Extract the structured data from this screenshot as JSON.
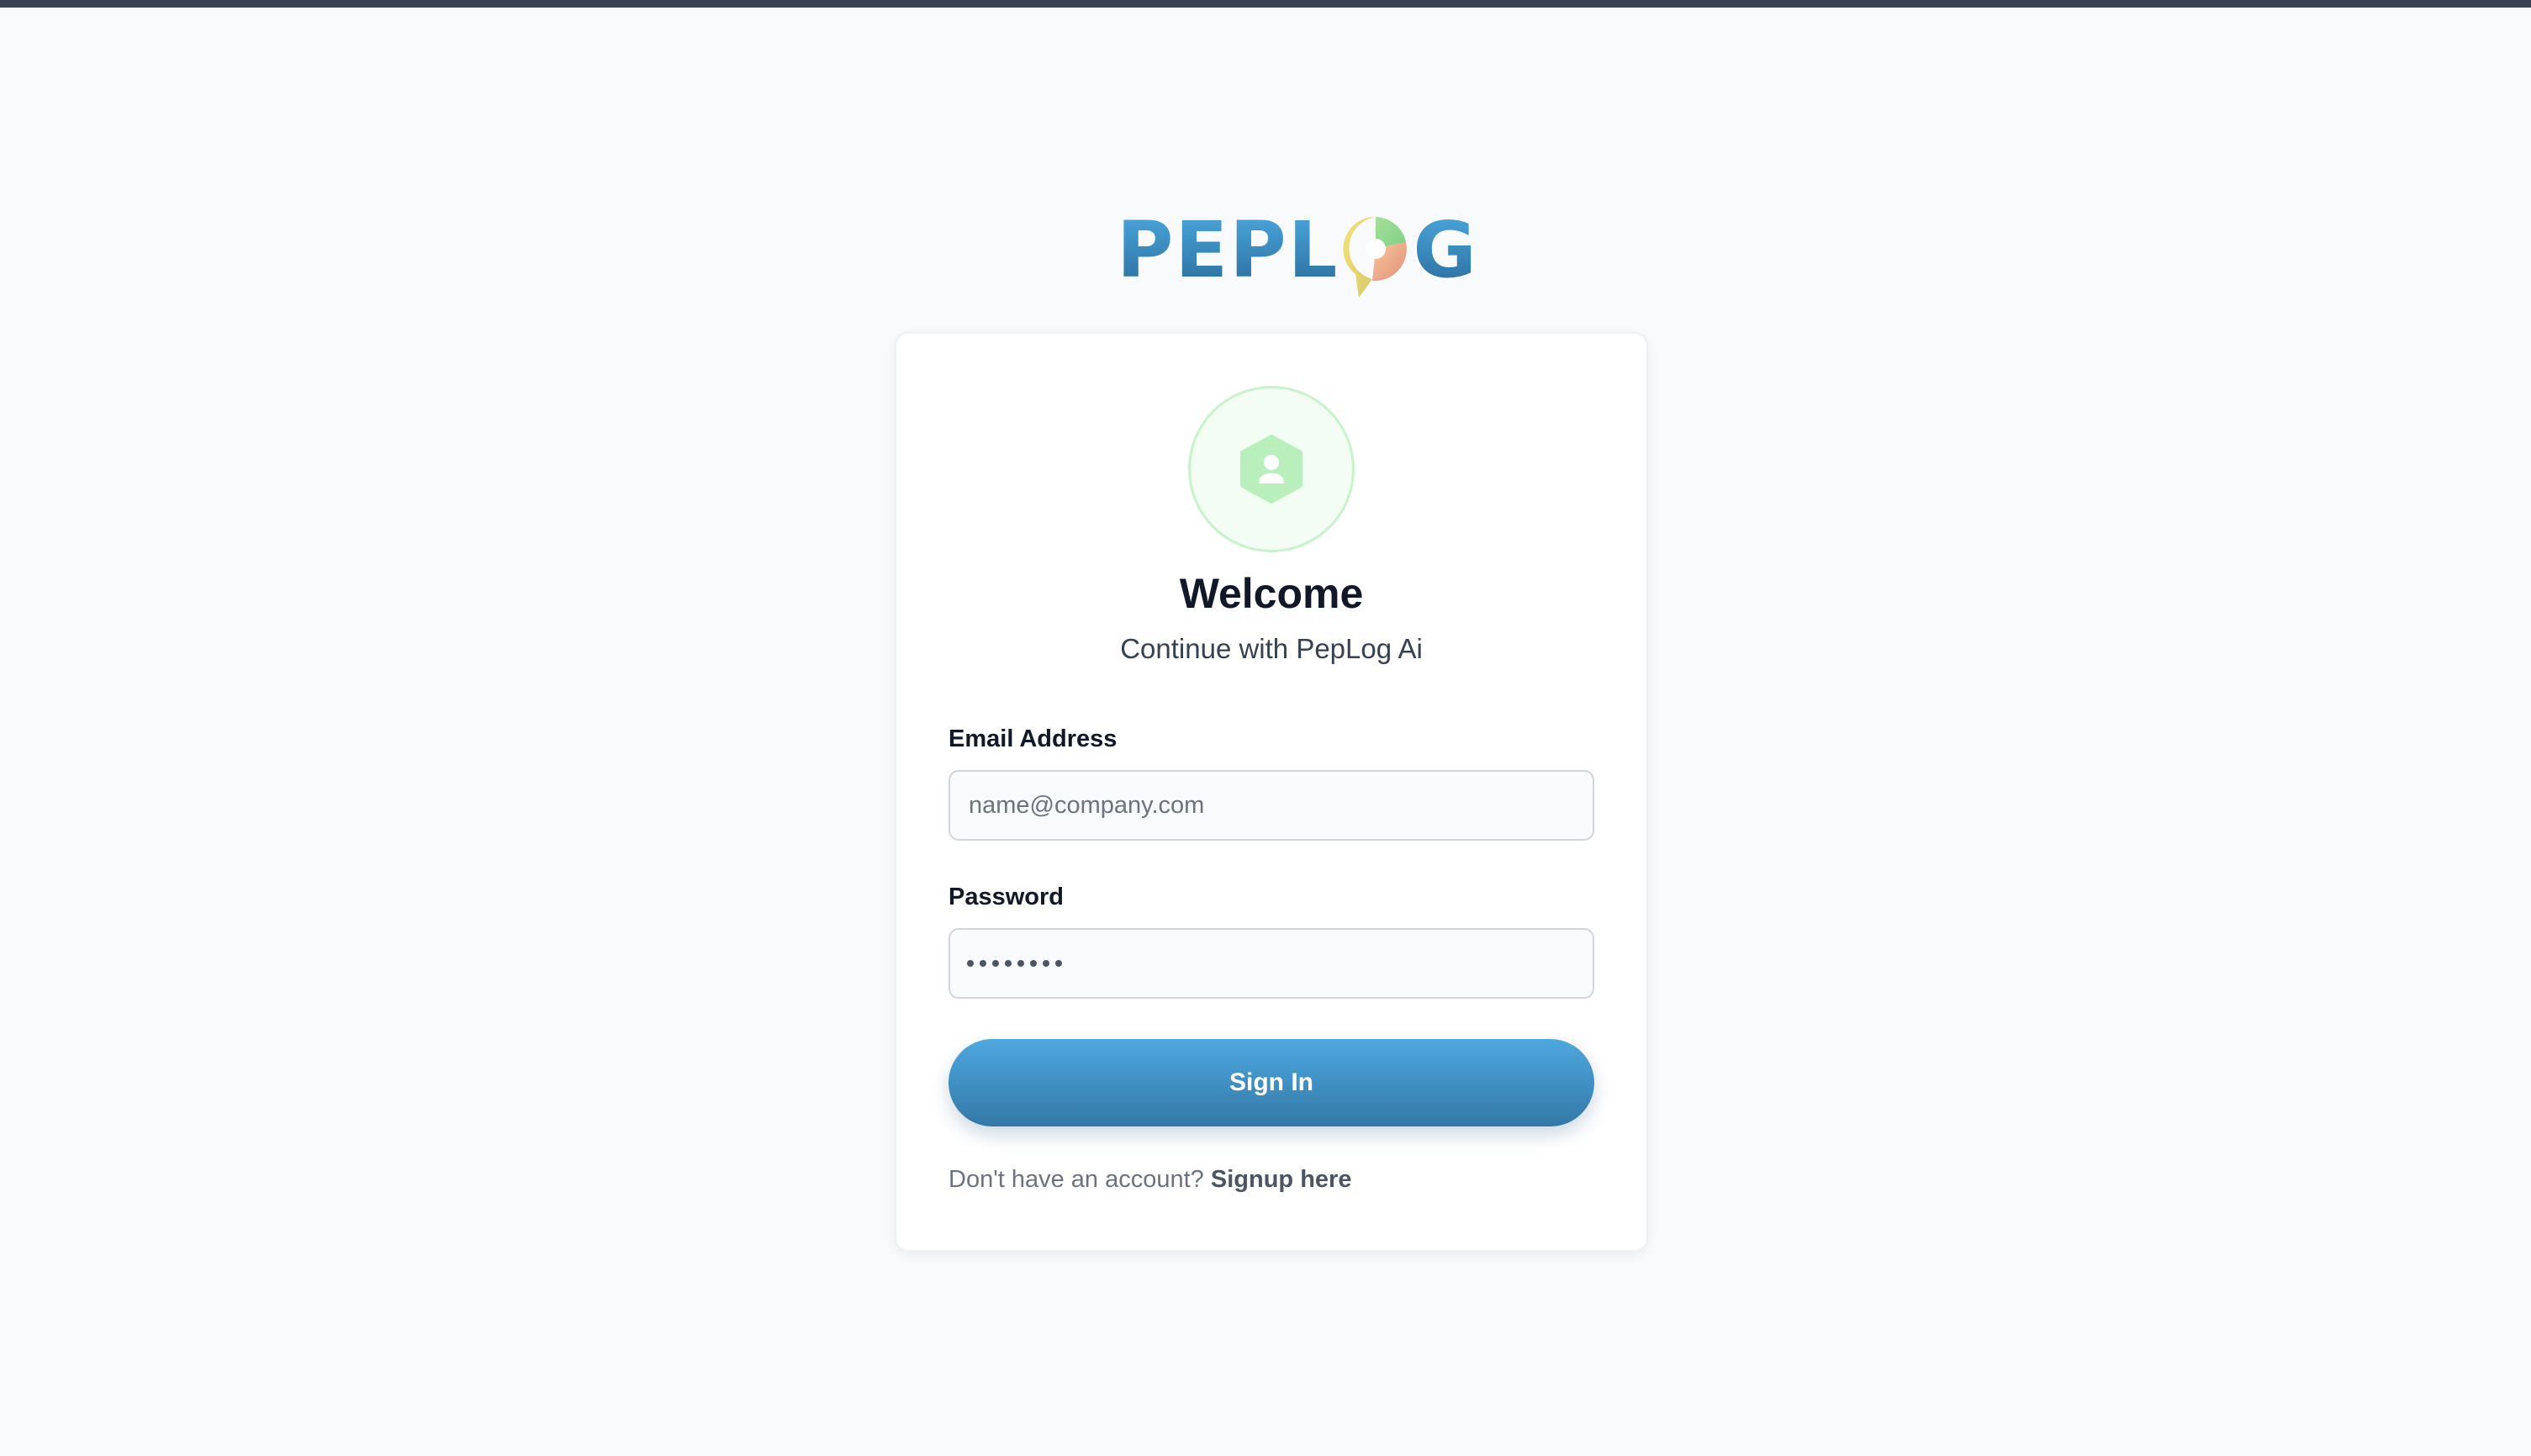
{
  "brand": {
    "logo_text_left": "PEPL",
    "logo_text_right": "G",
    "logo_name": "PEPLOG",
    "colors": {
      "primary": "#3b8fc6",
      "avatar_bg": "#f3fdf3",
      "avatar_icon": "#b9efbd"
    }
  },
  "login_card": {
    "title": "Welcome",
    "subtitle": "Continue with PepLog Ai",
    "email": {
      "label": "Email Address",
      "placeholder": "name@company.com",
      "value": ""
    },
    "password": {
      "label": "Password",
      "masked_value": "••••••••"
    },
    "submit_label": "Sign In",
    "signup_prompt": "Don't have an account?",
    "signup_link": "Signup here"
  },
  "icons": {
    "logo_mark": "speech-bubble-pie-icon",
    "avatar": "user-hexagon-icon"
  }
}
